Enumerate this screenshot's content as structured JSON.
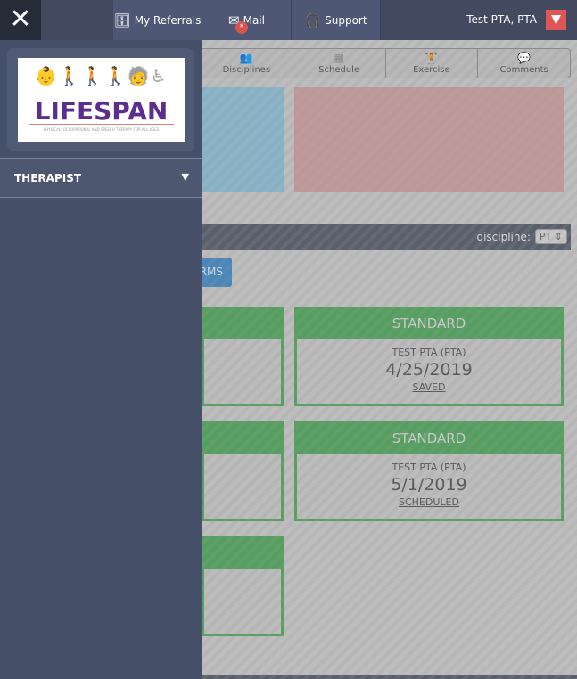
{
  "header": {
    "nav": [
      {
        "label": "My Referrals",
        "icon": "referrals-icon"
      },
      {
        "label": "Mail",
        "icon": "mail-icon",
        "badge": "*"
      },
      {
        "label": "Support",
        "icon": "support-icon"
      }
    ],
    "user": "Test PTA, PTA"
  },
  "sidebar": {
    "logo": {
      "name": "LIFESPAN",
      "tagline": "PHYSICAL, OCCUPATIONAL AND SPEECH THERAPY FOR ALL AGES"
    },
    "section": "THERAPIST"
  },
  "tabs": [
    "Disciplines",
    "Schedule",
    "Exercise",
    "Comments"
  ],
  "filter": {
    "label": "discipline:",
    "value": "PT"
  },
  "button": "RMS",
  "cards": [
    {
      "type": "STANDARD",
      "name": "TEST PTA (PTA)",
      "date": "4/25/2019",
      "status": "SAVED"
    },
    {
      "type": "STANDARD",
      "name": "TEST PTA (PTA)",
      "date": "5/1/2019",
      "status": "SCHEDULED"
    }
  ]
}
